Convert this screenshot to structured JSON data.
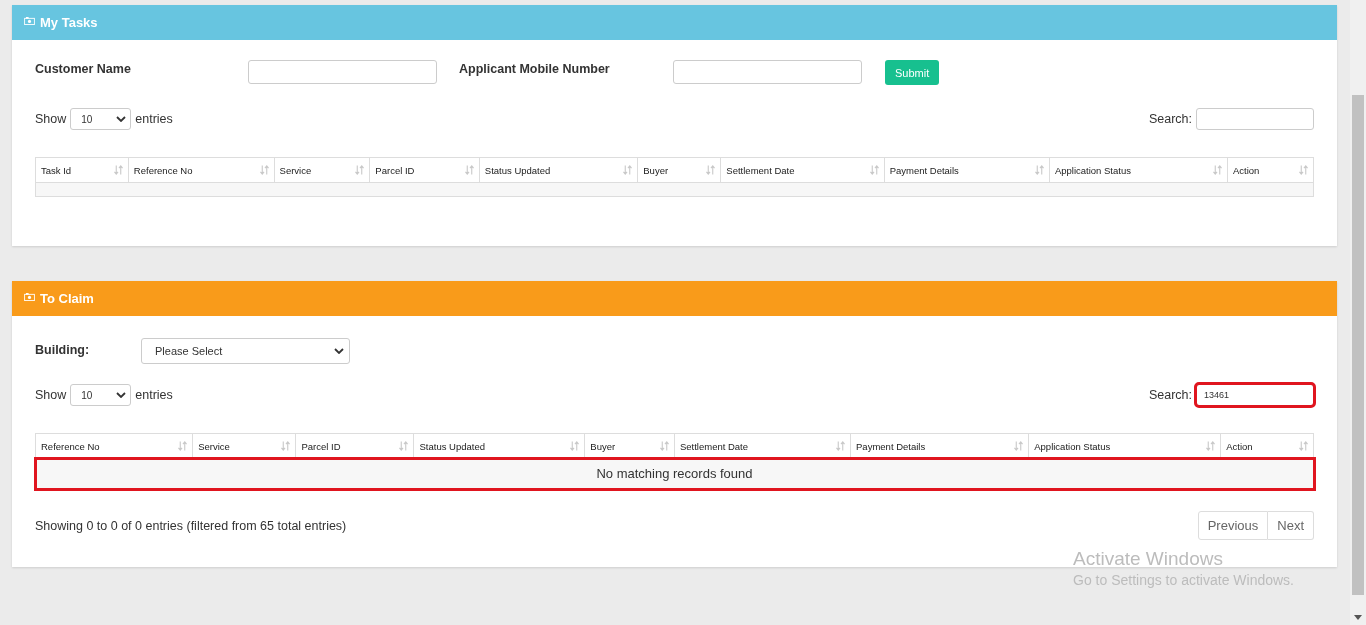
{
  "panels": [
    {
      "kind": "tasks",
      "title": "My Tasks",
      "color": "#67c5e0",
      "filters": [
        {
          "kind": "input",
          "label": "Customer Name"
        },
        {
          "kind": "input",
          "label": "Applicant Mobile Number"
        },
        {
          "kind": "button",
          "label": "Submit"
        }
      ],
      "length": {
        "show": "Show",
        "value": "10",
        "entries": "entries"
      },
      "search": {
        "label": "Search:",
        "highlighted": false
      },
      "columns": [
        "Task Id",
        "Reference No",
        "Service",
        "Parcel ID",
        "Status Updated",
        "Buyer",
        "Settlement Date",
        "Payment Details",
        "Application Status",
        "Action"
      ],
      "empty_row": {
        "highlighted": false
      }
    },
    {
      "kind": "claim",
      "title": "To Claim",
      "color": "#f99b1a",
      "filters": [
        {
          "kind": "select",
          "label": "Building:",
          "value": "Please Select"
        }
      ],
      "length": {
        "show": "Show",
        "value": "10",
        "entries": "entries"
      },
      "search": {
        "label": "Search:",
        "value": "13461",
        "highlighted": true
      },
      "columns": [
        "Reference No",
        "Service",
        "Parcel ID",
        "Status Updated",
        "Buyer",
        "Settlement Date",
        "Payment Details",
        "Application Status",
        "Action"
      ],
      "empty_row": {
        "text": "No matching records found",
        "highlighted": true
      },
      "info": "Showing 0 to 0 of 0 entries (filtered from 65 total entries)",
      "pager": [
        "Previous",
        "Next"
      ]
    }
  ],
  "overlay": {
    "title": "Activate Windows",
    "subtitle": "Go to Settings to activate Windows."
  }
}
